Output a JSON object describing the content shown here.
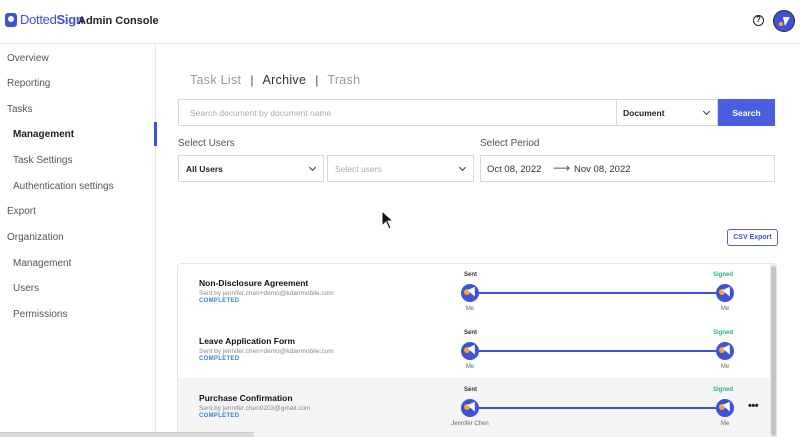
{
  "header": {
    "logo_text_dotted": "Dotted",
    "logo_text_sign": "Sign",
    "title": "Admin Console",
    "help_symbol": "?"
  },
  "sidebar": {
    "items": [
      {
        "label": "Overview",
        "level": "top",
        "active": false
      },
      {
        "label": "Reporting",
        "level": "top",
        "active": false
      },
      {
        "label": "Tasks",
        "level": "top",
        "active": false
      },
      {
        "label": "Management",
        "level": "sub",
        "active": true
      },
      {
        "label": "Task Settings",
        "level": "sub",
        "active": false
      },
      {
        "label": "Authentication settings",
        "level": "sub",
        "active": false
      },
      {
        "label": "Export",
        "level": "top",
        "active": false
      },
      {
        "label": "Organization",
        "level": "top",
        "active": false
      },
      {
        "label": "Management",
        "level": "sub",
        "active": false
      },
      {
        "label": "Users",
        "level": "sub",
        "active": false
      },
      {
        "label": "Permissions",
        "level": "sub",
        "active": false
      }
    ]
  },
  "tabs": [
    {
      "label": "Task List",
      "active": false
    },
    {
      "label": "Archive",
      "active": true
    },
    {
      "label": "Trash",
      "active": false
    }
  ],
  "tab_separator": "|",
  "search": {
    "placeholder": "Search document by document name",
    "type_selected": "Document",
    "button_label": "Search"
  },
  "filters": {
    "users_label": "Select Users",
    "users_selected": "All Users",
    "users_placeholder": "Select users",
    "period_label": "Select Period",
    "period_start": "Oct 08, 2022",
    "period_arrow": "⟶",
    "period_end": "Nov 08, 2022"
  },
  "csv_export_label": "CSV Export",
  "documents": [
    {
      "title": "Non-Disclosure Agreement",
      "sender": "Sent by jennifer.chen+demo@kdanmobile.com",
      "status": "COMPLETED",
      "sent_label": "Sent",
      "signed_label": "Signed",
      "sent_by": "Me",
      "signed_by": "Me"
    },
    {
      "title": "Leave Application Form",
      "sender": "Sent by jennifer.chen+demo@kdanmobile.com",
      "status": "COMPLETED",
      "sent_label": "Sent",
      "signed_label": "Signed",
      "sent_by": "Me",
      "signed_by": "Me"
    },
    {
      "title": "Purchase Confirmation",
      "sender": "Sent by jennifer.chen0203@gmail.com",
      "status": "COMPLETED",
      "sent_label": "Sent",
      "signed_label": "Signed",
      "sent_by": "Jennifer Chen",
      "signed_by": "Me"
    }
  ],
  "more_symbol": "•••",
  "colors": {
    "brand": "#3f51d8",
    "button": "#4a5fe0",
    "signed": "#2bb08a",
    "completed": "#3a83d0"
  }
}
